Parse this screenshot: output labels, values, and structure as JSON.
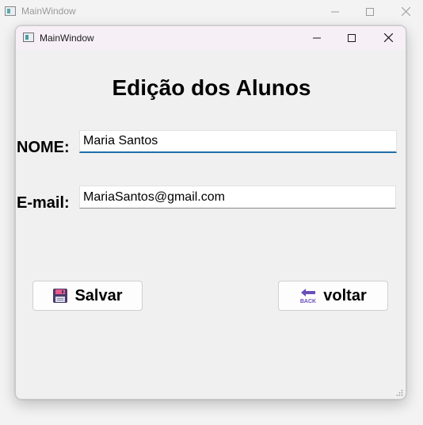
{
  "parent_window": {
    "title": "MainWindow",
    "controls": {
      "minimize": "—",
      "maximize": "☐",
      "close": "✕"
    }
  },
  "window": {
    "title": "MainWindow"
  },
  "form": {
    "heading": "Edição dos Alunos",
    "nome_label": "NOME:",
    "nome_value": "Maria Santos",
    "email_label": "E-mail:",
    "email_value": "MariaSantos@gmail.com"
  },
  "buttons": {
    "save_label": "Salvar",
    "back_label": "voltar",
    "back_icon_text": "BACK"
  },
  "colors": {
    "focus_accent": "#1f6fa8",
    "back_icon": "#6b4fbb",
    "save_icon": "#4a3a6a"
  },
  "icons": {
    "save": "floppy-disk-icon",
    "back": "back-arrow-icon"
  }
}
